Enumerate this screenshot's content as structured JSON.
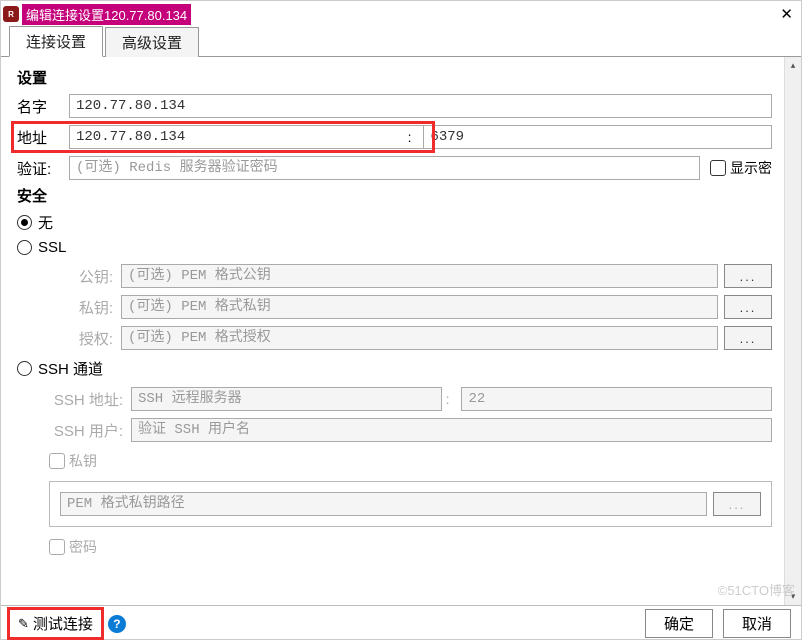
{
  "titlebar": {
    "app_icon_text": "R",
    "title": "编辑连接设置120.77.80.134",
    "close": "✕"
  },
  "tabs": {
    "conn": "连接设置",
    "adv": "高级设置"
  },
  "settings": {
    "header": "设置",
    "name_label": "名字",
    "name_value": "120.77.80.134",
    "addr_label": "地址",
    "addr_value": "120.77.80.134",
    "port_value": "6379",
    "auth_label": "验证:",
    "auth_placeholder": "(可选) Redis 服务器验证密码",
    "showpwd_label": "显示密"
  },
  "security": {
    "header": "安全",
    "none": "无",
    "ssl": "SSL",
    "pubkey_label": "公钥:",
    "pubkey_placeholder": "(可选) PEM 格式公钥",
    "privkey_label": "私钥:",
    "privkey_placeholder": "(可选) PEM 格式私钥",
    "authkey_label": "授权:",
    "authkey_placeholder": "(可选) PEM 格式授权",
    "browse": "...",
    "ssh": "SSH 通道",
    "ssh_addr_label": "SSH 地址:",
    "ssh_addr_placeholder": "SSH 远程服务器",
    "ssh_port_placeholder": "22",
    "ssh_user_label": "SSH 用户:",
    "ssh_user_placeholder": "验证 SSH 用户名",
    "ssh_priv_label": "私钥",
    "pem_path_placeholder": "PEM 格式私钥路径",
    "ssh_pwd_label": "密码"
  },
  "bottom": {
    "test": "测试连接",
    "help": "?",
    "ok": "确定",
    "cancel": "取消"
  },
  "watermark": "©51CTO博客"
}
